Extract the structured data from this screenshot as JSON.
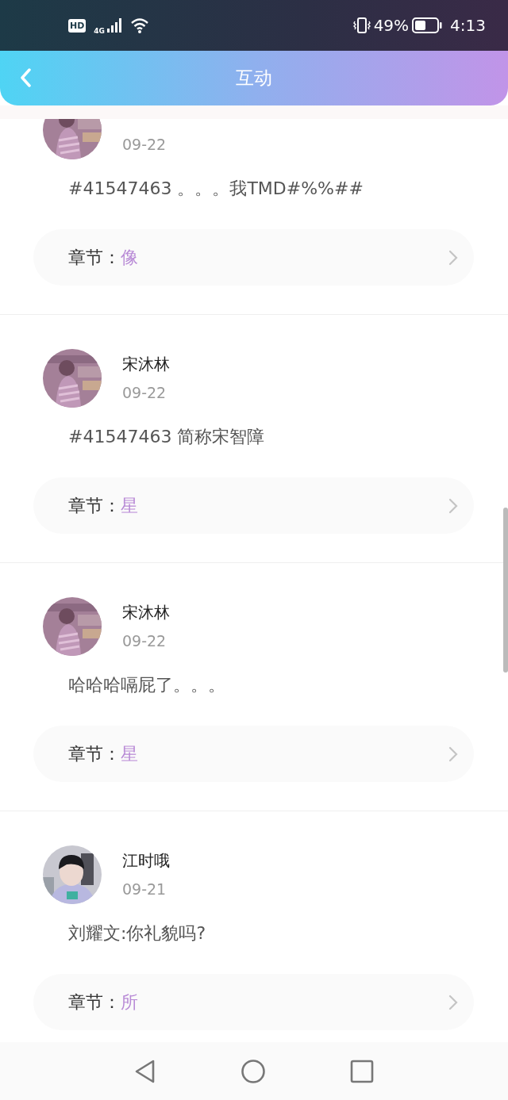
{
  "status_bar": {
    "hd": "HD",
    "network": "4G",
    "battery": "49%",
    "time": "4:13"
  },
  "header": {
    "title": "互动"
  },
  "comments": [
    {
      "date": "09-22",
      "text": "#41547463 。。。我TMD#%%##",
      "chapter_label": "章节：",
      "chapter": "像"
    },
    {
      "name": "宋沐林",
      "date": "09-22",
      "text": "#41547463 简称宋智障",
      "chapter_label": "章节：",
      "chapter": "星"
    },
    {
      "name": "宋沐林",
      "date": "09-22",
      "text": "哈哈哈嗝屁了。。。",
      "chapter_label": "章节：",
      "chapter": "星"
    },
    {
      "name": "江时哦",
      "date": "09-21",
      "text": "刘耀文:你礼貌吗?",
      "chapter_label": "章节：",
      "chapter": "所",
      "avatar": {
        "kind": "person"
      }
    }
  ]
}
